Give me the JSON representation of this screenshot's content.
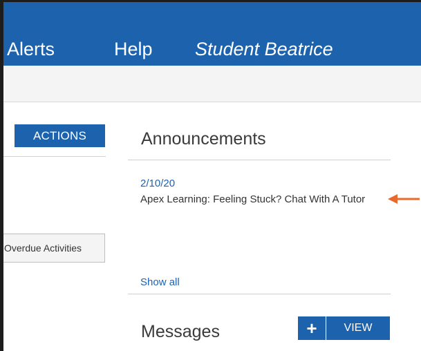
{
  "navbar": {
    "items": [
      {
        "label": "Alerts"
      },
      {
        "label": "Help"
      },
      {
        "label": "Student Beatrice"
      }
    ]
  },
  "left_panel": {
    "actions_label": "ACTIONS",
    "overdue_label": "Overdue Activities"
  },
  "announcements": {
    "title": "Announcements",
    "items": [
      {
        "date": "2/10/20",
        "text": "Apex Learning: Feeling Stuck? Chat With A Tutor"
      }
    ],
    "show_all_label": "Show all"
  },
  "messages": {
    "title": "Messages",
    "add_label": "+",
    "view_label": "VIEW"
  },
  "colors": {
    "brand": "#1c62ad",
    "arrow": "#e8692c"
  }
}
